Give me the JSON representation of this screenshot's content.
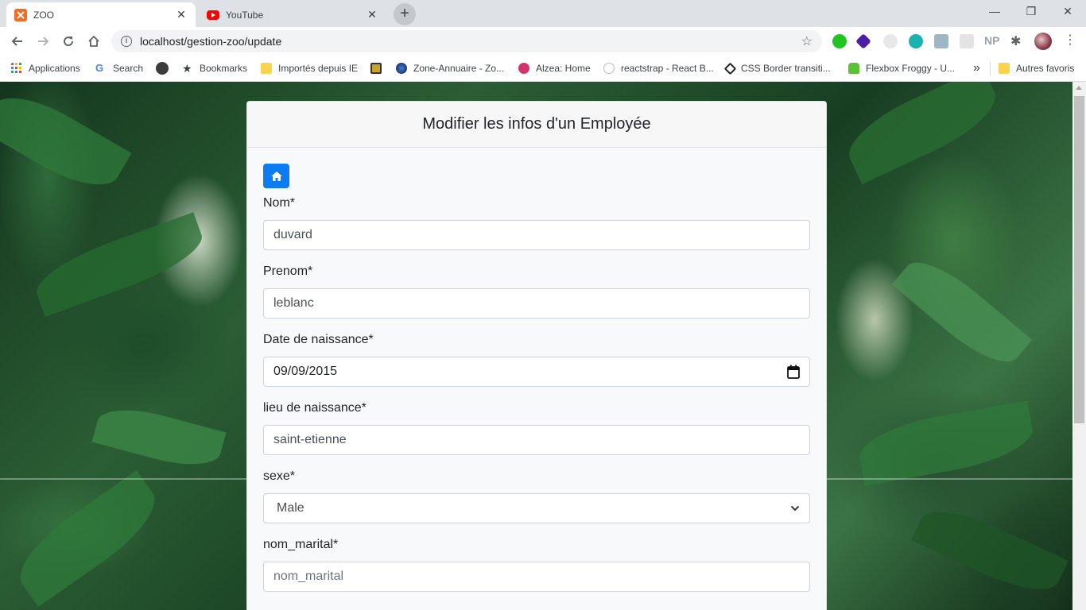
{
  "browser": {
    "tabs": [
      {
        "title": "ZOO",
        "active": true,
        "icon": "xampp-icon",
        "color": "#f26b21"
      },
      {
        "title": "YouTube",
        "active": false,
        "icon": "youtube-icon",
        "color": "#ff0000"
      }
    ],
    "url": "localhost/gestion-zoo/update",
    "bookmarks": [
      {
        "label": "Applications",
        "icon": "apps-grid-icon"
      },
      {
        "label": "Search",
        "icon": "google-icon"
      },
      {
        "label": "",
        "icon": "dark-circle-icon"
      },
      {
        "label": "Bookmarks",
        "icon": "star-icon"
      },
      {
        "label": "Importés depuis IE",
        "icon": "folder-icon"
      },
      {
        "label": "",
        "icon": "yellow-square-icon"
      },
      {
        "label": "Zone-Annuaire - Zo...",
        "icon": "globe-icon"
      },
      {
        "label": "Alzea: Home",
        "icon": "alzea-icon"
      },
      {
        "label": "reactstrap - React B...",
        "icon": "react-icon"
      },
      {
        "label": "CSS Border transiti...",
        "icon": "codepen-icon"
      },
      {
        "label": "Flexbox Froggy - U...",
        "icon": "frog-icon"
      },
      {
        "label": "Autres favoris",
        "icon": "folder-icon"
      }
    ],
    "overflow_label": "»",
    "np_label": "NP"
  },
  "page": {
    "title": "Modifier les infos d'un Employée",
    "fields": [
      {
        "label": "Nom*",
        "value": "duvard",
        "type": "text"
      },
      {
        "label": "Prenom*",
        "value": "leblanc",
        "type": "text"
      },
      {
        "label": "Date de naissance*",
        "value": "09/09/2015",
        "type": "date"
      },
      {
        "label": "lieu de naissance*",
        "value": "saint-etienne",
        "type": "text"
      },
      {
        "label": "sexe*",
        "value": "Male",
        "type": "select"
      },
      {
        "label": "nom_marital*",
        "placeholder": "nom_marital",
        "type": "text"
      }
    ]
  },
  "colors": {
    "home_button": "#0d7cf2",
    "card_bg": "#f8f9fa"
  }
}
